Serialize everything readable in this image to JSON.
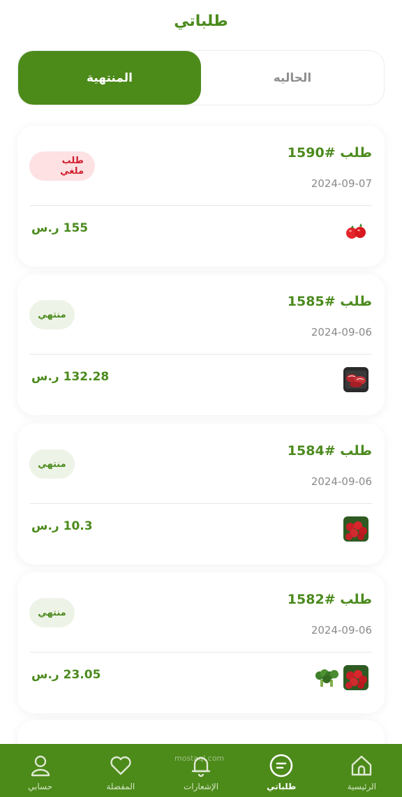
{
  "page": {
    "title": "طلباتي"
  },
  "tabs": [
    {
      "label": "الحاليه",
      "active": false
    },
    {
      "label": "المنتهية",
      "active": true
    }
  ],
  "orders": [
    {
      "title": "طلب #1590",
      "date": "2024-09-07",
      "status": "طلب ملغي",
      "status_type": "cancel",
      "price": "155 ر.س",
      "items": [
        "tomato-icon"
      ]
    },
    {
      "title": "طلب #1585",
      "date": "2024-09-06",
      "status": "منتهي",
      "status_type": "done",
      "price": "132.28 ر.س",
      "items": [
        "meat-icon"
      ]
    },
    {
      "title": "طلب #1584",
      "date": "2024-09-06",
      "status": "منتهي",
      "status_type": "done",
      "price": "10.3 ر.س",
      "items": [
        "tomatoes-icon"
      ]
    },
    {
      "title": "طلب #1582",
      "date": "2024-09-06",
      "status": "منتهي",
      "status_type": "done",
      "price": "23.05 ر.س",
      "items": [
        "tomatoes-icon",
        "broccoli-icon"
      ]
    }
  ],
  "bottom_nav": [
    {
      "label": "الرئيسية",
      "icon": "home-icon",
      "active": false
    },
    {
      "label": "طلباتي",
      "icon": "orders-icon",
      "active": true
    },
    {
      "label": "الإشعارات",
      "icon": "bell-icon",
      "active": false
    },
    {
      "label": "المفضلة",
      "icon": "heart-icon",
      "active": false
    },
    {
      "label": "حسابي",
      "icon": "user-icon",
      "active": false
    }
  ],
  "watermark": "mostaql.com",
  "colors": {
    "brand_green": "#4c8a1a",
    "cancel_red": "#d01e2d",
    "cancel_bg": "#fde1e3",
    "done_bg": "#eef3e7"
  }
}
